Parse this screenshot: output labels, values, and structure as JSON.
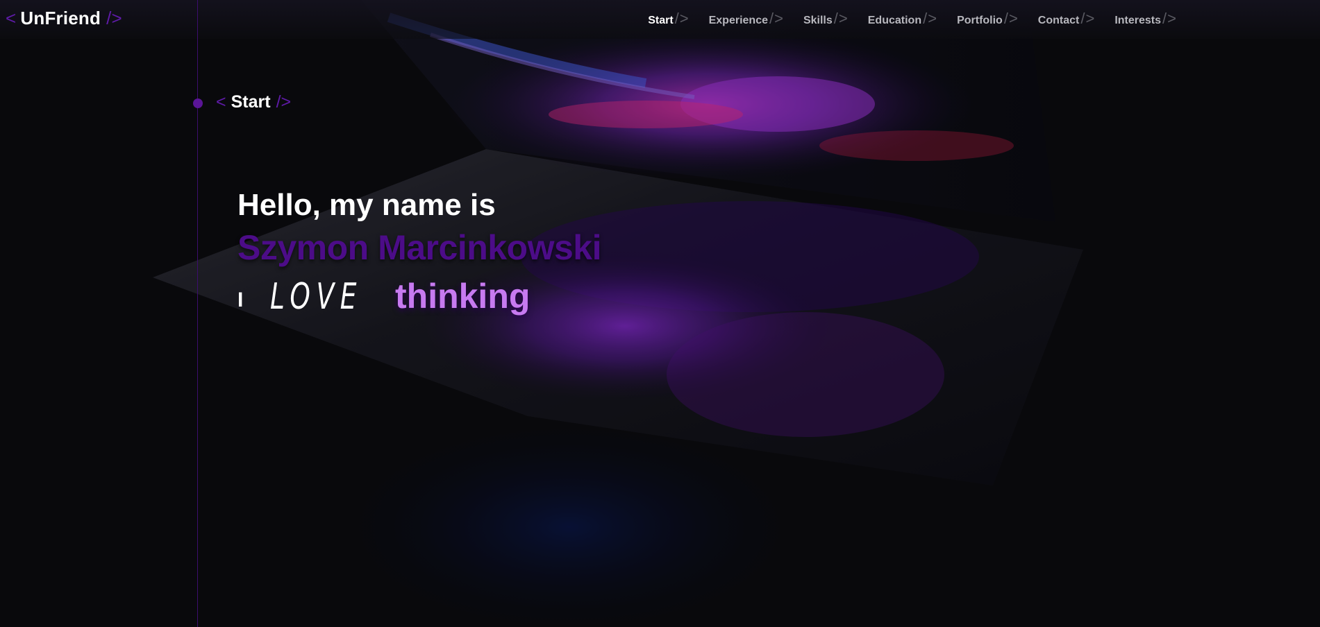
{
  "header": {
    "brand": {
      "open_bracket": "<",
      "name": "UnFriend",
      "close_bracket": "/>"
    },
    "nav": {
      "separator": "/>",
      "items": [
        {
          "label": "Start",
          "active": true
        },
        {
          "label": "Experience",
          "active": false
        },
        {
          "label": "Skills",
          "active": false
        },
        {
          "label": "Education",
          "active": false
        },
        {
          "label": "Portfolio",
          "active": false
        },
        {
          "label": "Contact",
          "active": false
        },
        {
          "label": "Interests",
          "active": false
        }
      ]
    }
  },
  "section": {
    "open_bracket": "<",
    "title": "Start",
    "close_bracket": "/>"
  },
  "hero": {
    "greeting": "Hello, my name is",
    "name": "Szymon Marcinkowski",
    "love_prefix": "I",
    "love_word": "LOVE",
    "love_object": "thinking"
  },
  "colors": {
    "accent": "#5f1ba8",
    "name": "#4c0c88",
    "highlight": "#c77af0",
    "background": "#0b0b0e",
    "timeline": "#3c0d6e"
  }
}
